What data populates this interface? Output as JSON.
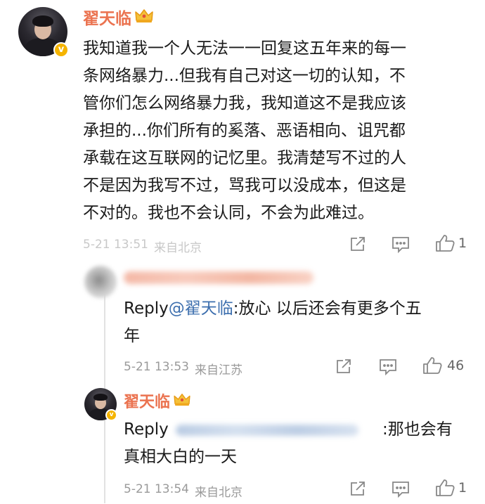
{
  "main_comment": {
    "username": "翟天临",
    "lines": [
      "我知道我一个人无法一一回复这五年来的每一",
      "条网络暴力...但我有自己对这一切的认知，不",
      "管你们怎么网络暴力我，我知道这不是我应该",
      "承担的...你们所有的奚落、恶语相向、诅咒都",
      "承载在这互联网的记忆里。我清楚写不过的人",
      "不是因为我写不过，骂我可以没成本，但这是",
      "不对的。我也不会认同，不会为此难过。"
    ],
    "timestamp": "5-21 13:51",
    "source": "来自北京",
    "like_count": "1"
  },
  "reply_1": {
    "reply_label": "Reply",
    "mention": "@翟天临",
    "text_line1": ":放心 以后还会有更多个五",
    "text_line2": "年",
    "timestamp": "5-21 13:53",
    "source": "来自江苏",
    "like_count": "46"
  },
  "reply_2": {
    "username": "翟天临",
    "reply_label": "Reply",
    "text_line1": ":那也会有",
    "text_line2": "真相大白的一天",
    "timestamp": "5-21 13:54",
    "source": "来自北京",
    "like_count": "1"
  },
  "icons": {
    "repost": "share-icon",
    "comment": "comment-icon",
    "like": "thumbs-up-icon",
    "verified": "verified-badge-icon",
    "crown": "crown-icon"
  },
  "colors": {
    "username": "#eb7350",
    "mention": "#3d6fae",
    "verified": "#f5b400"
  }
}
